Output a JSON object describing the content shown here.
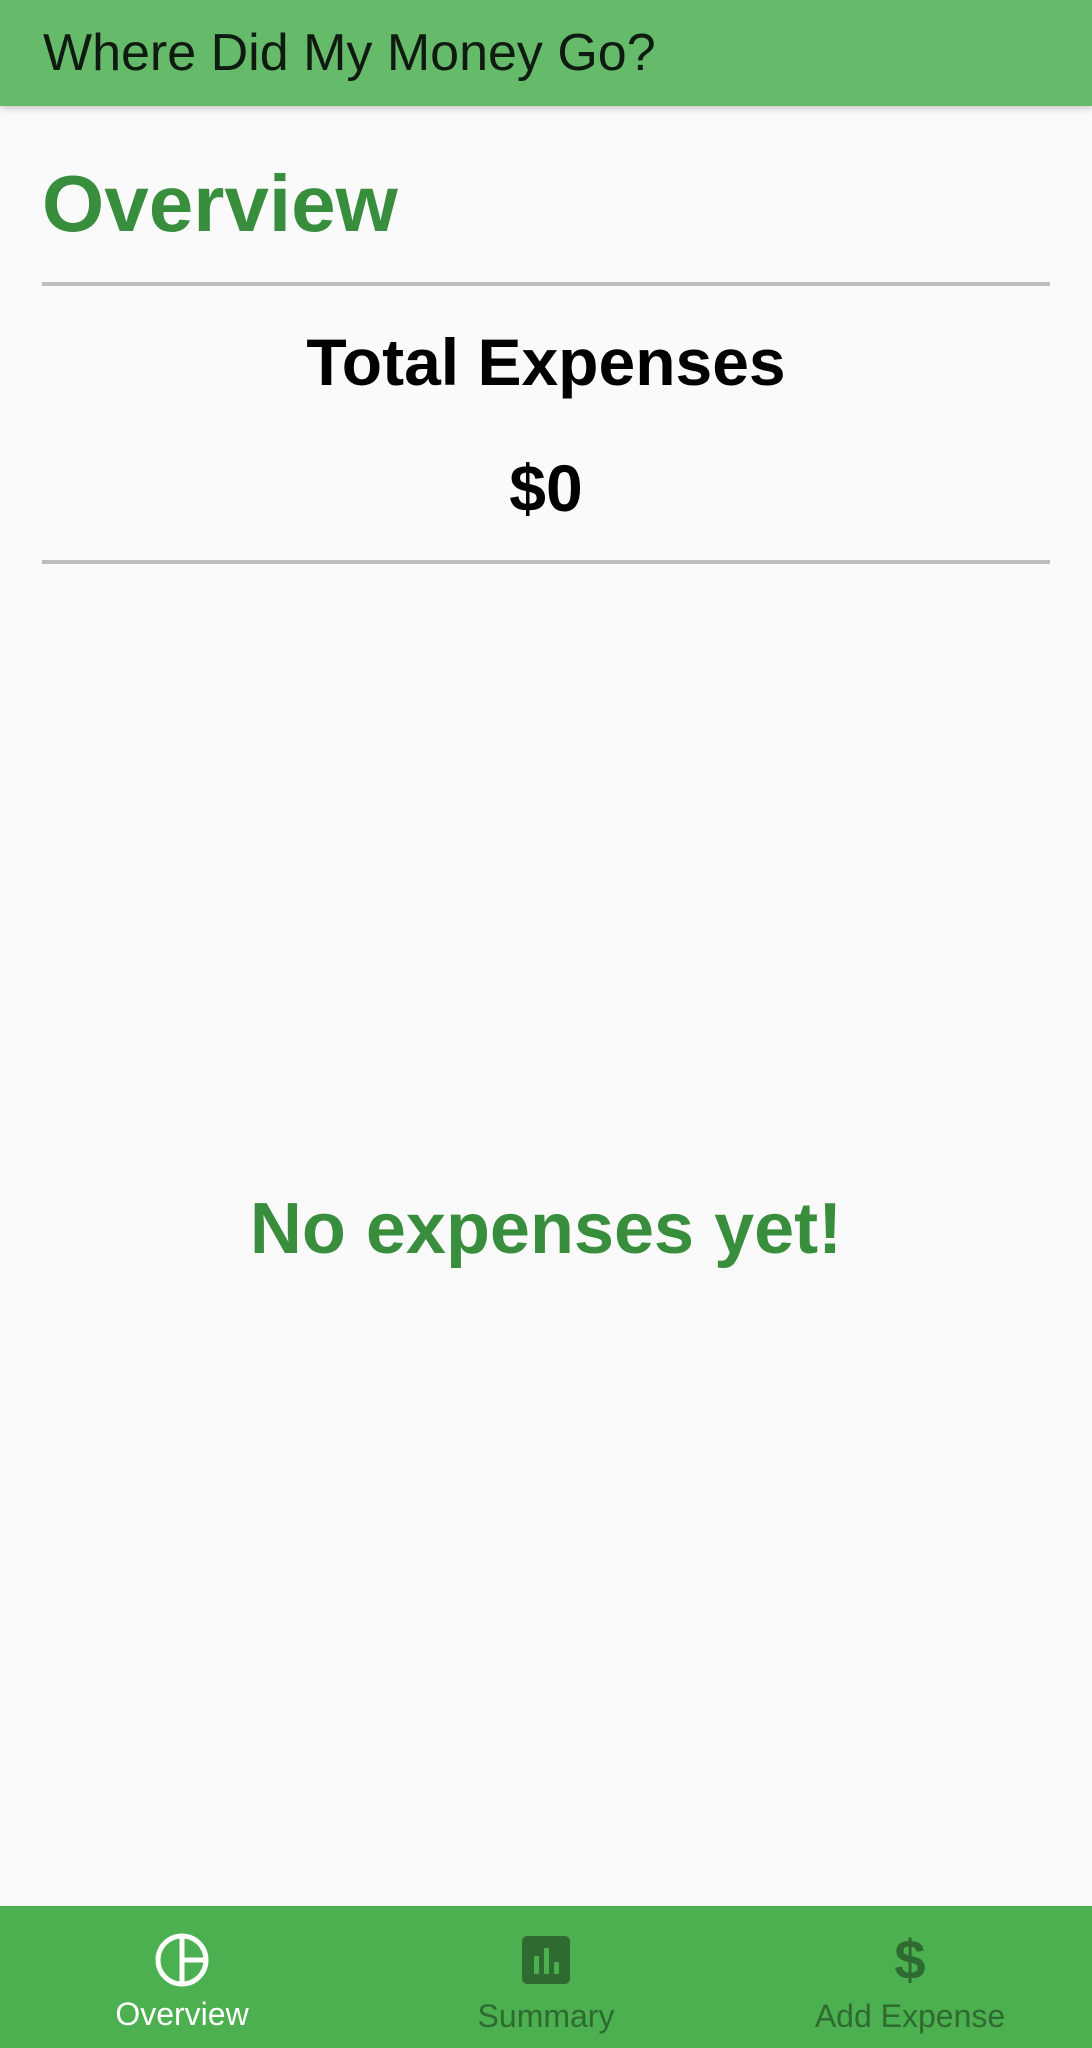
{
  "app_bar": {
    "title": "Where Did My Money Go?"
  },
  "main": {
    "heading": "Overview",
    "total_label": "Total Expenses",
    "total_value": "$0",
    "empty_message": "No expenses yet!"
  },
  "bottom_nav": {
    "items": [
      {
        "label": "Overview",
        "icon": "pie-chart-icon",
        "active": true
      },
      {
        "label": "Summary",
        "icon": "bar-chart-icon",
        "active": false
      },
      {
        "label": "Add Expense",
        "icon": "dollar-icon",
        "active": false
      }
    ]
  },
  "colors": {
    "app_bar": "#66bb6a",
    "accent_text": "#388e3c",
    "bottom_nav": "#4caf50",
    "inactive_nav": "#2e6b31",
    "active_nav": "#ffffff",
    "divider": "#bdbdbd",
    "background": "#fafafa"
  }
}
